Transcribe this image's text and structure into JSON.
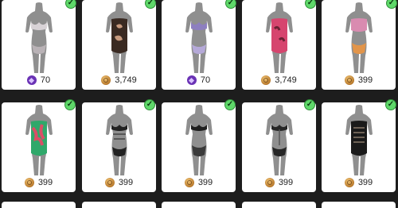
{
  "items": [
    {
      "price": "70",
      "currency": "gem",
      "owned": true,
      "colors": [
        "#d8d2d6",
        "#b9b2b6"
      ]
    },
    {
      "price": "3,749",
      "currency": "coin",
      "owned": true,
      "colors": [
        "#3a2a22",
        "#c79a7e"
      ]
    },
    {
      "price": "70",
      "currency": "gem",
      "owned": true,
      "colors": [
        "#8d7fbf",
        "#b5a9d8"
      ]
    },
    {
      "price": "3,749",
      "currency": "coin",
      "owned": true,
      "colors": [
        "#d6456e",
        "#6a2334"
      ]
    },
    {
      "price": "399",
      "currency": "coin",
      "owned": true,
      "colors": [
        "#d98bb0",
        "#e2954a"
      ]
    },
    {
      "price": "399",
      "currency": "coin",
      "owned": true,
      "colors": [
        "#2fa86a",
        "#d94f66"
      ]
    },
    {
      "price": "399",
      "currency": "coin",
      "owned": true,
      "colors": [
        "#222222",
        "#444444"
      ]
    },
    {
      "price": "399",
      "currency": "coin",
      "owned": true,
      "colors": [
        "#1f1f1f",
        "#3a3a3a"
      ]
    },
    {
      "price": "399",
      "currency": "coin",
      "owned": true,
      "colors": [
        "#262626",
        "#555555"
      ]
    },
    {
      "price": "399",
      "currency": "coin",
      "owned": true,
      "colors": [
        "#1a1a1a",
        "#8a7a6a"
      ]
    }
  ],
  "colors": {
    "background": "#1d1d1d",
    "card": "#ffffff",
    "check": "#5fd86a",
    "coin": "#c4873a",
    "gem": "#6a32b5"
  }
}
